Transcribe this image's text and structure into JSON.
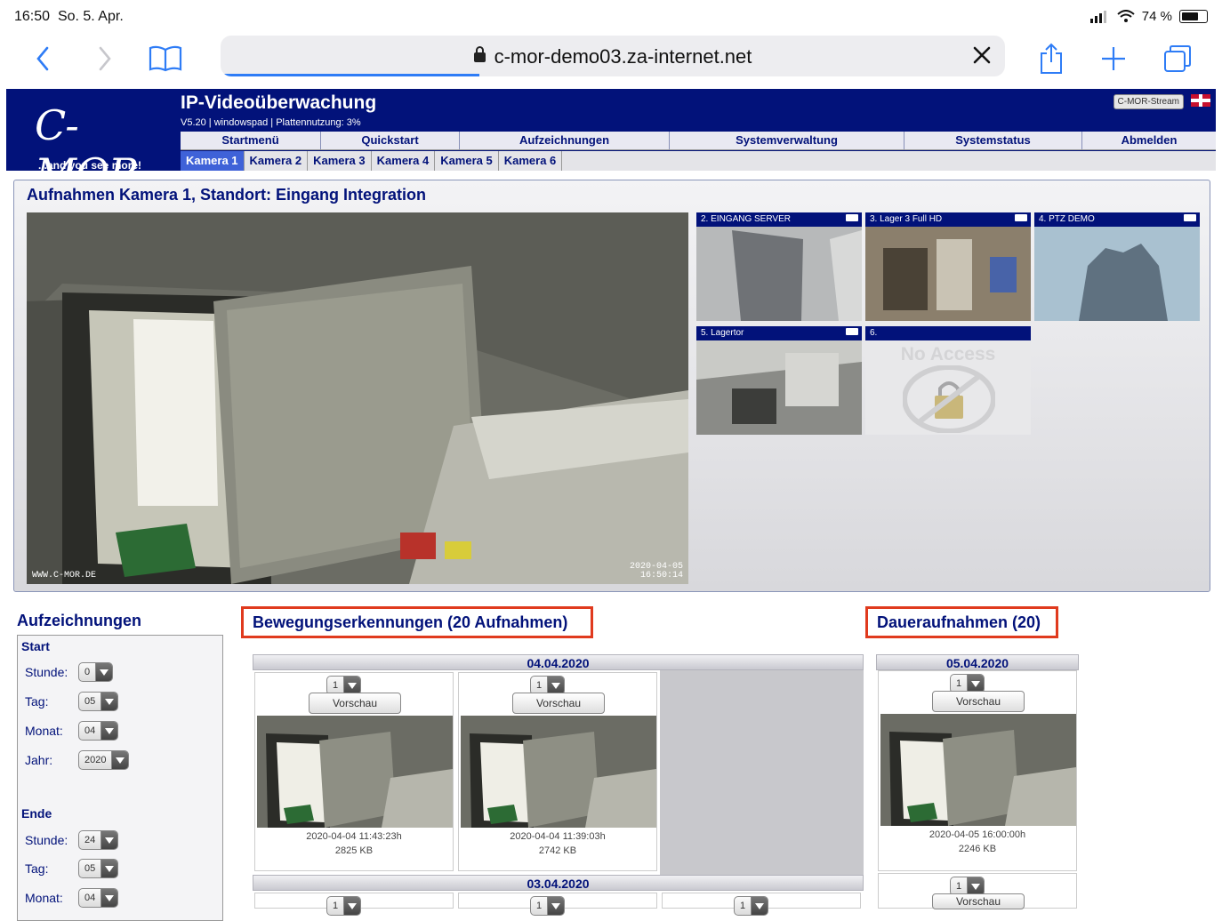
{
  "statusbar": {
    "time": "16:50",
    "date": "So. 5. Apr.",
    "battery": "74 %",
    "battery_level": 0.74
  },
  "browser": {
    "url": "c-mor-demo03.za-internet.net",
    "load_progress": 0.33
  },
  "header": {
    "logo": "C-MOR",
    "slogan": "...and you see more!",
    "title": "IP-Videoüberwachung",
    "subtitle": "V5.20 | windowspad | Plattennutzung: 3%",
    "stream_button": "C-MOR-Stream",
    "menu": [
      {
        "label": "Startmenü"
      },
      {
        "label": "Quickstart"
      },
      {
        "label": "Aufzeichnungen"
      },
      {
        "label": "Systemverwaltung"
      },
      {
        "label": "Systemstatus"
      },
      {
        "label": "Abmelden"
      }
    ],
    "camera_tabs": [
      "Kamera 1",
      "Kamera 2",
      "Kamera 3",
      "Kamera 4",
      "Kamera 5",
      "Kamera 6"
    ]
  },
  "camera_view": {
    "title": "Aufnahmen Kamera 1, Standort: Eingang Integration",
    "watermark": "WWW.C-MOR.DE",
    "timestamp_date": "2020-04-05",
    "timestamp_time": "16:50:14",
    "thumbnails": [
      {
        "label": "2. EINGANG SERVER"
      },
      {
        "label": "3. Lager 3 Full HD"
      },
      {
        "label": "4. PTZ DEMO"
      },
      {
        "label": "5. Lagertor"
      },
      {
        "label": "6.",
        "overlay": "No Access"
      }
    ]
  },
  "recordings": {
    "title": "Aufzeichnungen",
    "start": {
      "heading": "Start",
      "fields": [
        {
          "label": "Stunde:",
          "value": "0"
        },
        {
          "label": "Tag:",
          "value": "05"
        },
        {
          "label": "Monat:",
          "value": "04"
        },
        {
          "label": "Jahr:",
          "value": "2020"
        }
      ]
    },
    "end": {
      "heading": "Ende",
      "fields": [
        {
          "label": "Stunde:",
          "value": "24"
        },
        {
          "label": "Tag:",
          "value": "05"
        },
        {
          "label": "Monat:",
          "value": "04"
        }
      ]
    }
  },
  "motion": {
    "title": "Bewegungserkennungen (20 Aufnahmen)",
    "day1": "04.04.2020",
    "day2": "03.04.2020",
    "items": [
      {
        "select": "1",
        "button": "Vorschau",
        "datetime": "2020-04-04 11:43:23h",
        "size": "2825 KB"
      },
      {
        "select": "1",
        "button": "Vorschau",
        "datetime": "2020-04-04 11:39:03h",
        "size": "2742 KB"
      }
    ],
    "next_row_selects": [
      "1",
      "1",
      "1"
    ]
  },
  "continuous": {
    "title": "Daueraufnahmen (20)",
    "day1": "05.04.2020",
    "items": [
      {
        "select": "1",
        "button": "Vorschau",
        "datetime": "2020-04-05 16:00:00h",
        "size": "2246 KB"
      }
    ],
    "next": {
      "select": "1",
      "button": "Vorschau"
    }
  },
  "colors": {
    "brand": "#02127a",
    "active_tab": "#3f62d8",
    "highlight": "#e03a1e"
  }
}
